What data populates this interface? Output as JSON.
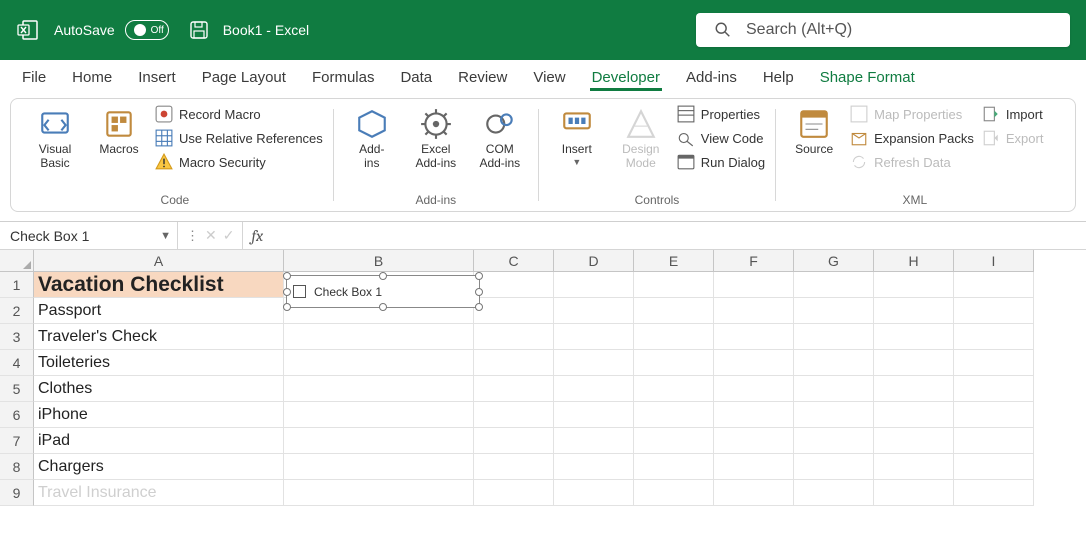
{
  "titlebar": {
    "autosave_label": "AutoSave",
    "autosave_state": "Off",
    "doc_title": "Book1  -  Excel",
    "search_placeholder": "Search (Alt+Q)"
  },
  "tabs": {
    "file": "File",
    "home": "Home",
    "insert": "Insert",
    "page_layout": "Page Layout",
    "formulas": "Formulas",
    "data": "Data",
    "review": "Review",
    "view": "View",
    "developer": "Developer",
    "addins": "Add-ins",
    "help": "Help",
    "shape_format": "Shape Format"
  },
  "ribbon": {
    "code": {
      "visual_basic": "Visual\nBasic",
      "macros": "Macros",
      "record_macro": "Record Macro",
      "use_relative": "Use Relative References",
      "macro_security": "Macro Security",
      "group": "Code"
    },
    "addins_grp": {
      "addins": "Add-\nins",
      "excel_addins": "Excel\nAdd-ins",
      "com_addins": "COM\nAdd-ins",
      "group": "Add-ins"
    },
    "controls": {
      "insert": "Insert",
      "design_mode": "Design\nMode",
      "properties": "Properties",
      "view_code": "View Code",
      "run_dialog": "Run Dialog",
      "group": "Controls"
    },
    "xml": {
      "source": "Source",
      "map_properties": "Map Properties",
      "expansion_packs": "Expansion Packs",
      "refresh_data": "Refresh Data",
      "import": "Import",
      "export": "Export",
      "group": "XML"
    }
  },
  "formulabar": {
    "namebox": "Check Box 1",
    "fx": "fx"
  },
  "columns": [
    "A",
    "B",
    "C",
    "D",
    "E",
    "F",
    "G",
    "H",
    "I"
  ],
  "rows": [
    {
      "n": "1",
      "a": "Vacation Checklist"
    },
    {
      "n": "2",
      "a": "Passport"
    },
    {
      "n": "3",
      "a": "Traveler's Check"
    },
    {
      "n": "4",
      "a": "Toileteries"
    },
    {
      "n": "5",
      "a": "Clothes"
    },
    {
      "n": "6",
      "a": "iPhone"
    },
    {
      "n": "7",
      "a": "iPad"
    },
    {
      "n": "8",
      "a": "Chargers"
    },
    {
      "n": "9",
      "a": "Travel Insurance"
    }
  ],
  "shape": {
    "label": "Check Box 1"
  }
}
